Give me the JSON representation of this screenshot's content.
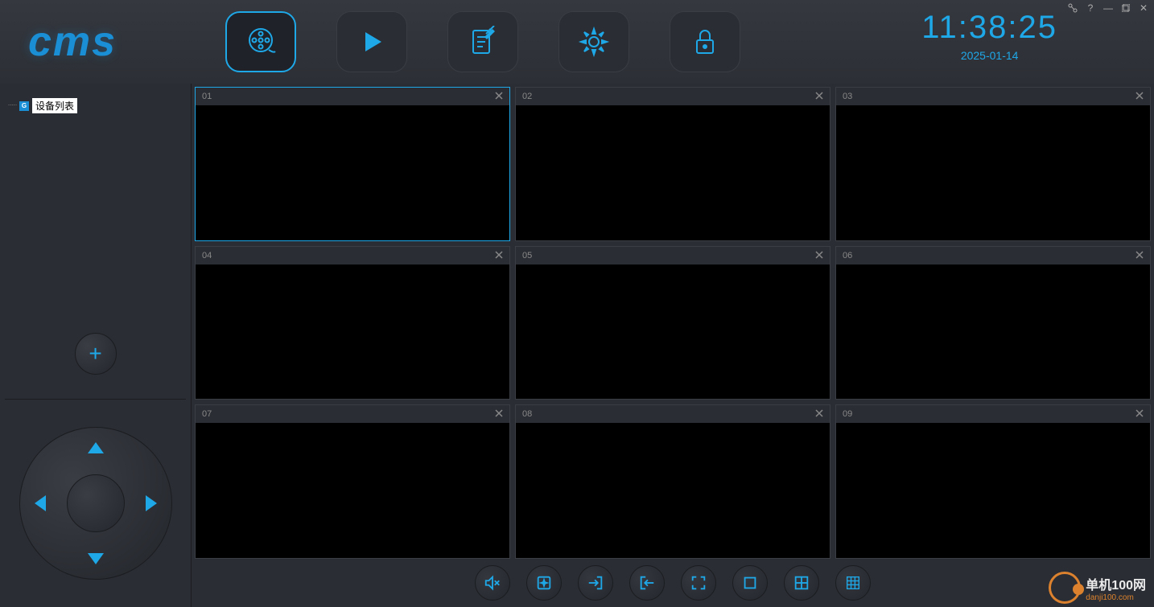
{
  "logo_text": "cms",
  "clock": {
    "time": "11:38:25",
    "date": "2025-01-14"
  },
  "sidebar": {
    "device_list_label": "设备列表",
    "tree_badge": "G"
  },
  "video_cells": [
    {
      "id": "01",
      "selected": true
    },
    {
      "id": "02",
      "selected": false
    },
    {
      "id": "03",
      "selected": false
    },
    {
      "id": "04",
      "selected": false
    },
    {
      "id": "05",
      "selected": false
    },
    {
      "id": "06",
      "selected": false
    },
    {
      "id": "07",
      "selected": false
    },
    {
      "id": "08",
      "selected": false
    },
    {
      "id": "09",
      "selected": false
    }
  ],
  "watermark": {
    "line1": "单机100网",
    "line2": "danji100.com"
  }
}
